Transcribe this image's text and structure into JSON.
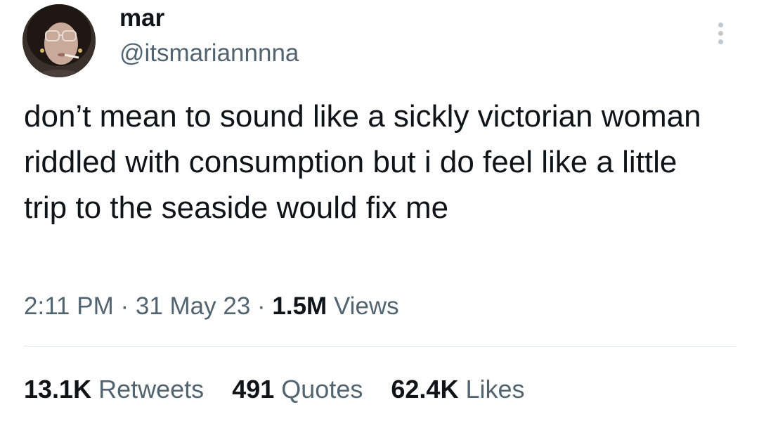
{
  "author": {
    "display_name": "mar",
    "handle": "@itsmariannnna",
    "avatar": "profile-photo"
  },
  "more_icon": "three-dots-vertical-icon",
  "tweet": {
    "text": "don’t mean to sound like a sickly victorian woman riddled with consumption but i do feel like a little trip to the seaside would fix me"
  },
  "meta": {
    "time": "2:11 PM",
    "separator": " · ",
    "date": "31 May 23",
    "views_count": "1.5M",
    "views_label": "Views"
  },
  "stats": [
    {
      "count": "13.1K",
      "label": "Retweets"
    },
    {
      "count": "491",
      "label": "Quotes"
    },
    {
      "count": "62.4K",
      "label": "Likes"
    }
  ],
  "colors": {
    "text_primary": "#0f1419",
    "text_secondary": "#536471",
    "divider": "#e1e6ea",
    "icon": "#c3c8cc"
  }
}
